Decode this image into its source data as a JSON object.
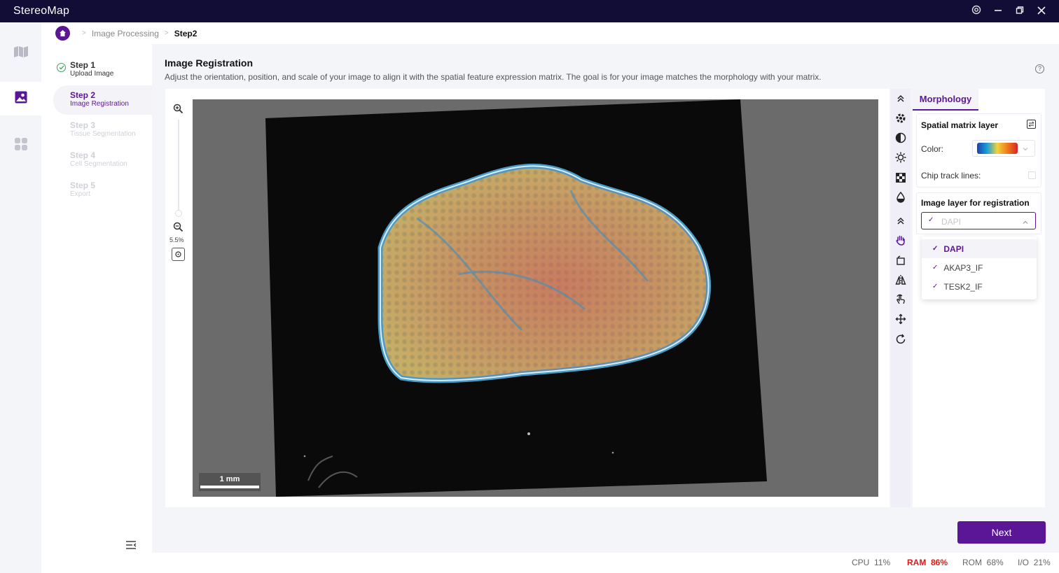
{
  "app": {
    "title": "StereoMap"
  },
  "breadcrumb": {
    "items": [
      "Image Processing",
      "Step2"
    ]
  },
  "steps": [
    {
      "title": "Step 1",
      "subtitle": "Upload Image",
      "state": "done"
    },
    {
      "title": "Step 2",
      "subtitle": "Image Registration",
      "state": "active"
    },
    {
      "title": "Step 3",
      "subtitle": "Tissue Segmentation",
      "state": "pending"
    },
    {
      "title": "Step 4",
      "subtitle": "Cell Segmentation",
      "state": "pending"
    },
    {
      "title": "Step 5",
      "subtitle": "Export",
      "state": "pending"
    }
  ],
  "main": {
    "title": "Image Registration",
    "description": "Adjust the orientation, position, and scale of your image to align it with the spatial feature expression matrix. The goal is for your image matches the morphology with your matrix."
  },
  "viewer": {
    "zoom": "5.5%",
    "scale_bar": "1 mm"
  },
  "panel": {
    "tab": "Morphology",
    "spatial_matrix": {
      "title": "Spatial matrix layer",
      "color_label": "Color:",
      "chip_track_label": "Chip track lines:",
      "chip_track_enabled": false
    },
    "registration": {
      "title": "Image layer for registration",
      "selected": "DAPI",
      "options": [
        "DAPI",
        "AKAP3_IF",
        "TESK2_IF"
      ]
    }
  },
  "actions": {
    "next": "Next"
  },
  "status": {
    "cpu_label": "CPU",
    "cpu": "11%",
    "ram_label": "RAM",
    "ram": "86%",
    "rom_label": "ROM",
    "rom": "68%",
    "io_label": "I/O",
    "io": "21%"
  },
  "colors": {
    "accent": "#5b1597",
    "titlebar": "#110d36",
    "alert": "#e01818"
  }
}
